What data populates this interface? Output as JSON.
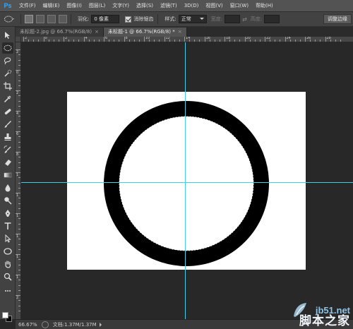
{
  "app": {
    "logo": "Ps"
  },
  "menu": [
    "文件(F)",
    "编辑(E)",
    "图像(I)",
    "图层(L)",
    "文字(Y)",
    "选择(S)",
    "滤镜(T)",
    "3D(D)",
    "视图(V)",
    "窗口(W)",
    "帮助(H)"
  ],
  "options": {
    "feather_label": "羽化:",
    "feather_value": "0 像素",
    "antialias_label": "消除锯齿",
    "style_label": "样式:",
    "style_value": "正常",
    "width_label": "宽度:",
    "height_label": "高度:",
    "refine_button": "调整边缘"
  },
  "tabs": [
    {
      "label": "未标题-2.jpg @ 66.7%(RGB/8)",
      "close": "×"
    },
    {
      "label": "未标题-1 @ 66.7%(RGB/8) *",
      "close": "×"
    }
  ],
  "ruler_top": [
    "2",
    "0",
    "2",
    "4",
    "6",
    "8",
    "10",
    "12",
    "14",
    "16",
    "18",
    "20",
    "22",
    "24",
    "26",
    "28"
  ],
  "ruler_left": [
    "2",
    "0",
    "2",
    "4",
    "6",
    "8",
    "1",
    "1",
    "1",
    "1",
    "1",
    "1",
    "2"
  ],
  "status": {
    "zoom": "66.67%",
    "doc_info": "文档:1.37M/1.37M"
  },
  "watermark": {
    "domain": "jb51.net",
    "name": "脚本之家"
  },
  "colors": {
    "guide": "#3fd0e8",
    "ring": "#000000",
    "canvas": "#ffffff",
    "workspace": "#282828"
  }
}
